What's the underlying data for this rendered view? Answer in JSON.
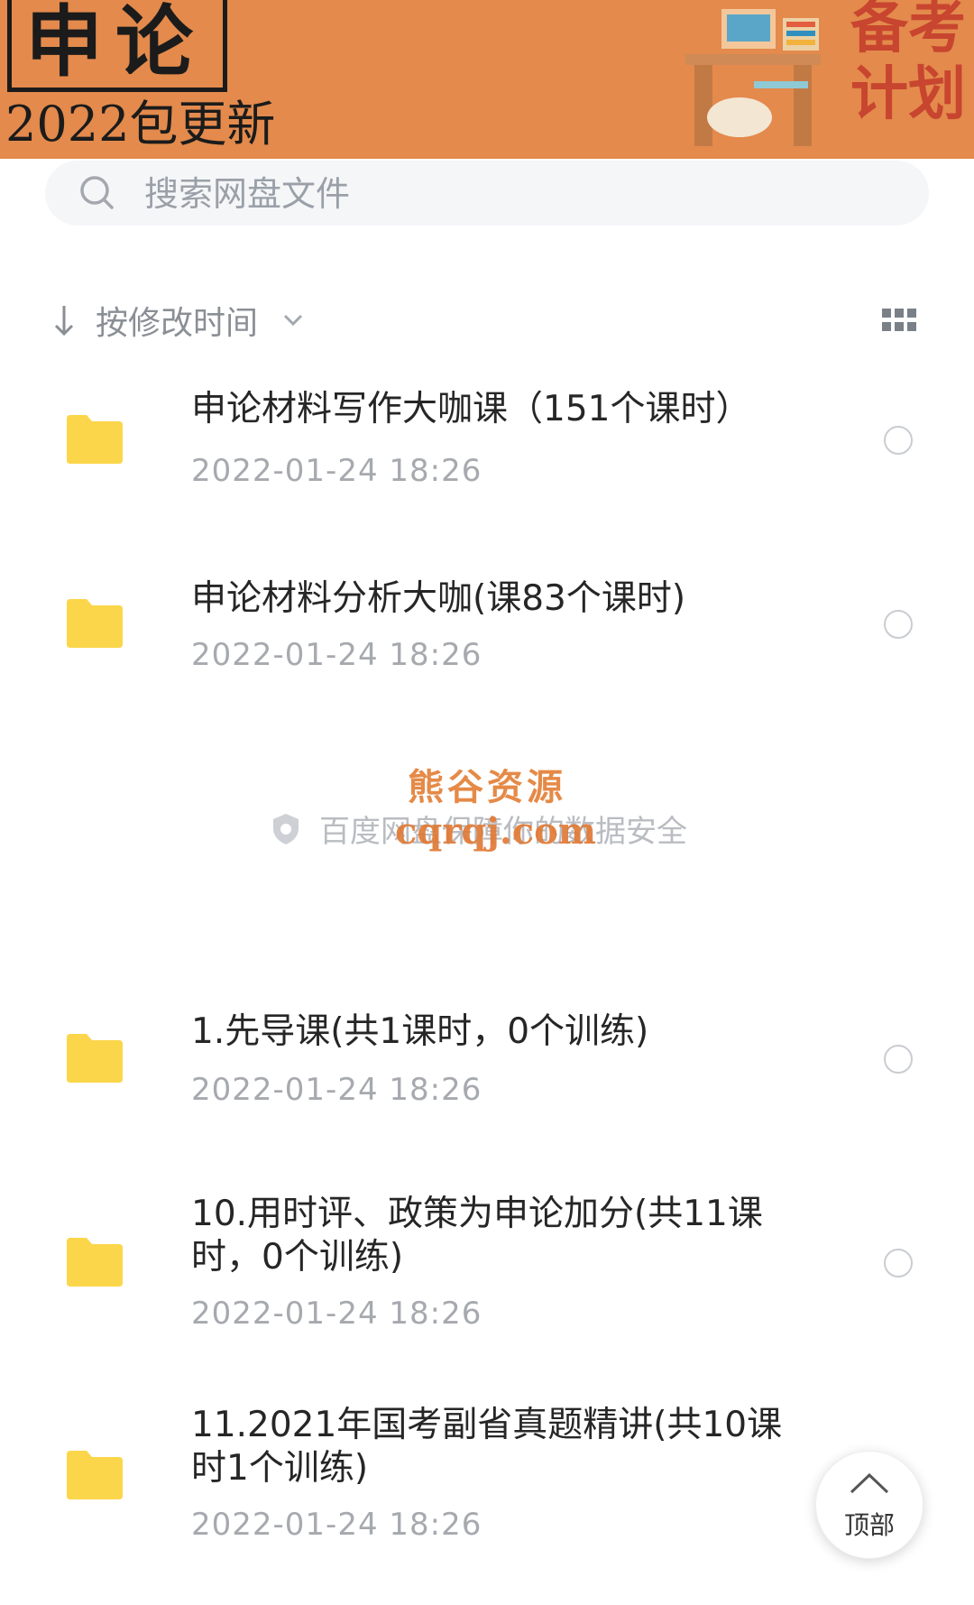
{
  "banner": {
    "title": "申论",
    "subtitle": "2022包更新",
    "plan_text": "备考计划",
    "colors": {
      "background": "#e38a4c",
      "title": "#1b1b1b",
      "plan": "#c8452f"
    }
  },
  "search": {
    "placeholder": "搜索网盘文件",
    "icon": "search-icon"
  },
  "sort": {
    "label": "按修改时间",
    "arrow_icon": "arrow-down-icon",
    "chevron_icon": "chevron-down-icon",
    "view_icon": "grid-view-icon"
  },
  "files": [
    {
      "name": "申论材料写作大咖课（151个课时）",
      "date": "2022-01-24  18:26"
    },
    {
      "name": "申论材料分析大咖(课83个课时)",
      "date": "2022-01-24  18:26"
    },
    {
      "name": "1.先导课(共1课时，0个训练)",
      "date": "2022-01-24  18:26"
    },
    {
      "name": "10.用时评、政策为申论加分(共11课时，0个训练)",
      "date": "2022-01-24  18:26"
    },
    {
      "name": "11.2021年国考副省真题精讲(共10课时1个训练)",
      "date": "2022-01-24  18:26"
    }
  ],
  "notice": {
    "text": "百度网盘保障你的数据安全",
    "icon": "shield-icon"
  },
  "watermark": {
    "title": "熊谷资源",
    "url": "cqrqj.com",
    "color": "#e58a47"
  },
  "back_to_top": {
    "label": "顶部",
    "icon": "chevron-up-icon"
  },
  "colors": {
    "folder": "#fbd64a",
    "date_text": "#a6a9ae",
    "name_text": "#262626"
  }
}
